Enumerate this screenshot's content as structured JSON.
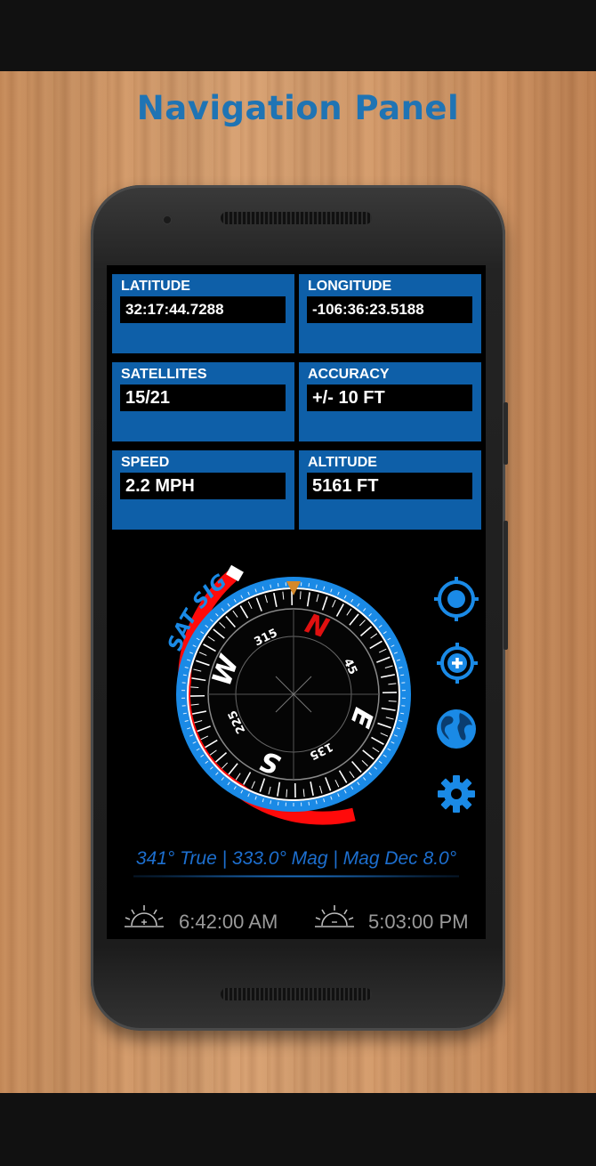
{
  "headline": "Navigation Panel",
  "cards": {
    "latitude": {
      "label": "LATITUDE",
      "value": "32:17:44.7288"
    },
    "longitude": {
      "label": "LONGITUDE",
      "value": "-106:36:23.5188"
    },
    "satellites": {
      "label": "SATELLITES",
      "value": "15/21"
    },
    "accuracy": {
      "label": "ACCURACY",
      "value": "+/- 10 FT"
    },
    "speed": {
      "label": "SPEED",
      "value": "2.2 MPH"
    },
    "altitude": {
      "label": "ALTITUDE",
      "value": "5161 FT"
    }
  },
  "compass": {
    "sat_sig_label": "SAT SIG",
    "north": "N",
    "east": "E",
    "south": "S",
    "west": "W",
    "deg_315": "315",
    "deg_45": "45",
    "deg_135": "135",
    "deg_225": "225"
  },
  "heading_text": "341° True | 333.0° Mag | Mag Dec 8.0°",
  "sunrise": "6:42:00 AM",
  "sunset": "5:03:00 PM",
  "icons": [
    "crosshair-icon",
    "zoom-target-icon",
    "globe-icon",
    "gear-icon",
    "sunrise-icon",
    "sunset-icon"
  ],
  "colors": {
    "panel_blue": "#0e5fa8",
    "accent_blue": "#1a8ae6",
    "signal_red": "#ff0a0a",
    "north_red": "#e01010"
  }
}
